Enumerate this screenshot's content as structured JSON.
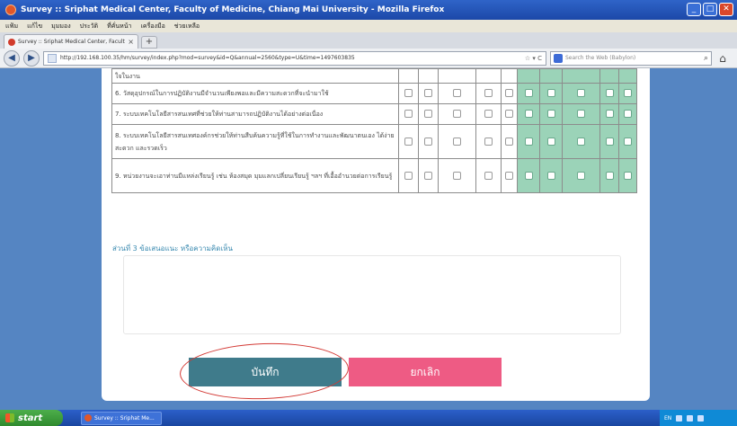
{
  "window": {
    "title": "Survey :: Sriphat Medical Center, Faculty of Medicine, Chiang Mai University - Mozilla Firefox",
    "controls": [
      "_",
      "□",
      "✕"
    ]
  },
  "menu": [
    "แฟ้ม",
    "แก้ไข",
    "มุมมอง",
    "ประวัติ",
    "ที่คั่นหน้า",
    "เครื่องมือ",
    "ช่วยเหลือ"
  ],
  "tab": {
    "label": "Survey :: Sriphat Medical Center, Faculty o...",
    "close": "×",
    "new_tab": "+"
  },
  "nav": {
    "back": "◀",
    "forward": "▶",
    "url": "http://192.168.100.35/hm/survey/index.php?mod=survey&id=Q&annual=2560&type=U&time=1497603835",
    "url_controls": "☆ ▾ C",
    "search_placeholder": "Search the Web (Babylon)",
    "search_go": "⌕",
    "home": "⌂"
  },
  "survey": {
    "rows": [
      {
        "text": "ใจในงาน"
      },
      {
        "text": "6. วัสดุอุปกรณ์ในการปฏิบัติงานมีจำนวนเพียงพอและมีความสะดวกที่จะนำมาใช้"
      },
      {
        "text": "7. ระบบเทคโนโลยีสารสนเทศที่ช่วยให้ท่านสามารถปฏิบัติงานได้อย่างต่อเนื่อง"
      },
      {
        "text": "8. ระบบเทคโนโลยีสารสนเทศองค์กรช่วยให้ท่านสืบค้นความรู้ที่ใช้ในการทำงานและพัฒนาตนเอง ได้ง่าย สะดวก และรวดเร็ว"
      },
      {
        "text": "9. หน่วยงานจะเอาท่านมีแหล่งเรียนรู้ เช่น ห้องสมุด มุมแลกเปลี่ยนเรียนรู้ ฯลฯ ที่เอื้ออำนวยต่อการเรียนรู้"
      }
    ],
    "section3_label": "ส่วนที่ 3 ข้อเสนอแนะ หรือความคิดเห็น",
    "comment_value": "",
    "save_label": "บันทึก",
    "cancel_label": "ยกเลิก"
  },
  "taskbar": {
    "start_label": "start",
    "task_label": "Survey :: Sriphat Me...",
    "tray_text": "EN"
  },
  "colors": {
    "save_button": "#3f7b8b",
    "cancel_button": "#ee5b84",
    "rating_highlight": "#9bd3b8",
    "page_background": "#5585c2",
    "annotation_circle": "#d33a35"
  }
}
